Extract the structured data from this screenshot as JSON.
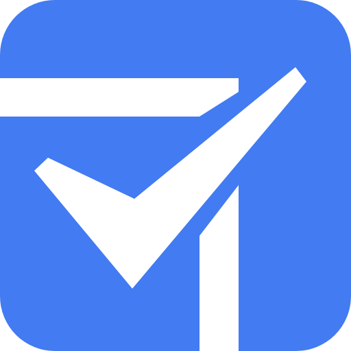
{
  "app_icon": {
    "icon_name": "task-checkmark-icon",
    "colors": {
      "background": "#ffffff",
      "tile": "#427BF2",
      "glyph": "#ffffff"
    }
  }
}
